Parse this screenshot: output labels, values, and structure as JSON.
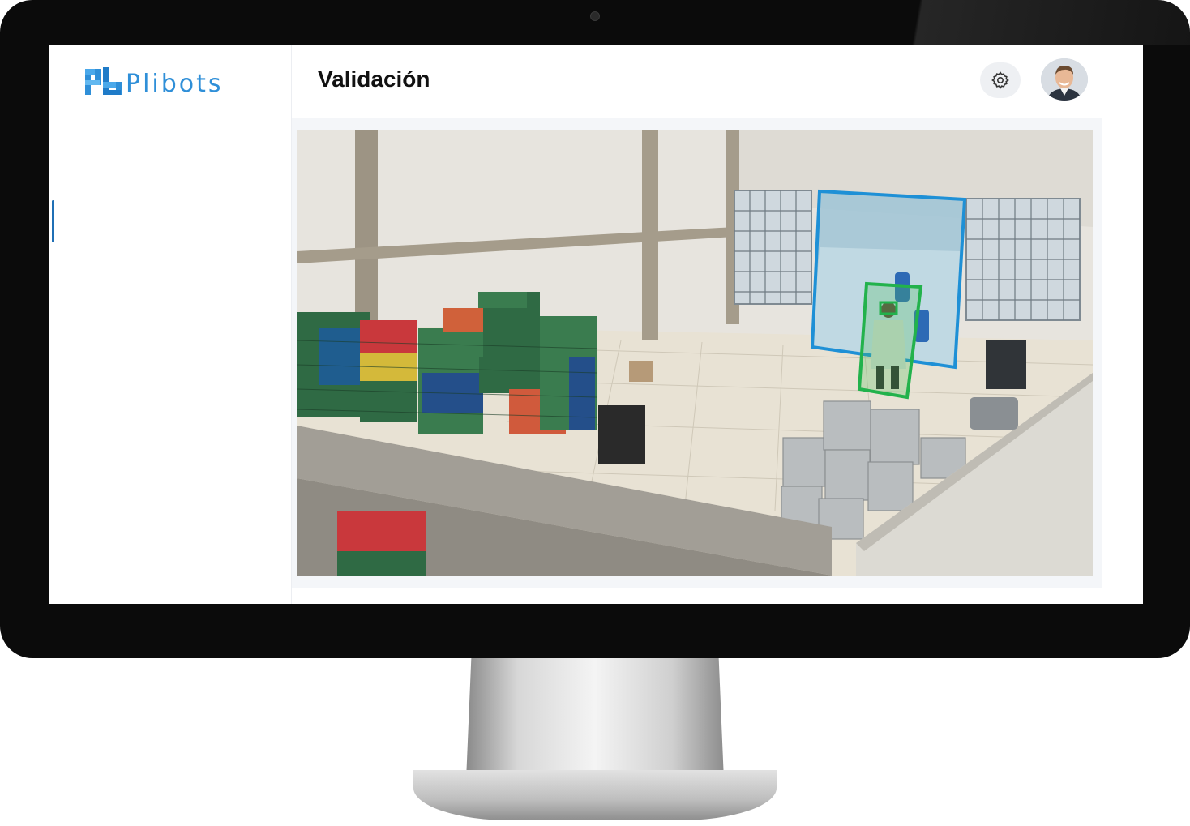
{
  "app": {
    "brand": "Plibots",
    "brand_colors": {
      "primary": "#2f8fd8",
      "accent": "#1f6fb5"
    }
  },
  "header": {
    "title": "Validación",
    "settings_icon": "gear-icon",
    "avatar_icon": "user-avatar"
  },
  "camera": {
    "feed_icon": "camera-feed",
    "detections": [
      {
        "type": "zone",
        "color": "#1e90d6"
      },
      {
        "type": "person",
        "color": "#22b24c"
      },
      {
        "type": "head",
        "color": "#22b24c"
      }
    ]
  }
}
